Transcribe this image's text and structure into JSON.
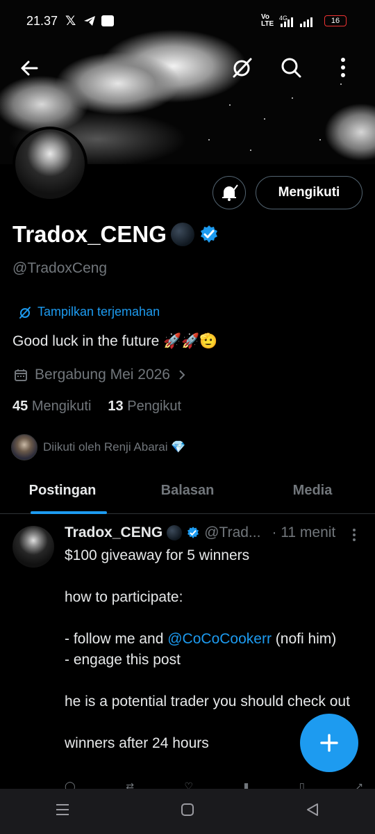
{
  "status_bar": {
    "time": "21.37",
    "battery": "16"
  },
  "profile": {
    "display_name": "Tradox_CENG",
    "handle": "@TradoxCeng",
    "translate_label": "Tampilkan terjemahan",
    "bio": "Good luck in the future 🚀🚀🫡",
    "joined": "Bergabung Mei 2026",
    "following_count": "45",
    "following_label": "Mengikuti",
    "followers_count": "13",
    "followers_label": "Pengikut",
    "followed_by": "Diikuti oleh Renji Abarai 💎",
    "follow_button": "Mengikuti"
  },
  "tabs": [
    {
      "label": "Postingan"
    },
    {
      "label": "Balasan"
    },
    {
      "label": "Media"
    }
  ],
  "post": {
    "name": "Tradox_CENG",
    "handle": "@Trad...",
    "time": "· 11 menit",
    "lines": [
      "$100 giveaway for 5 winners",
      "",
      "how to participate:",
      "",
      "- follow me and ",
      "- engage this post",
      "",
      "he is a potential trader you should check out",
      "",
      "winners after 24 hours"
    ],
    "mention": "@CoCoCookerr",
    "mention_suffix": " (nofi him)"
  },
  "colors": {
    "accent": "#1d9bf0",
    "muted": "#71767b",
    "background": "#000000"
  }
}
